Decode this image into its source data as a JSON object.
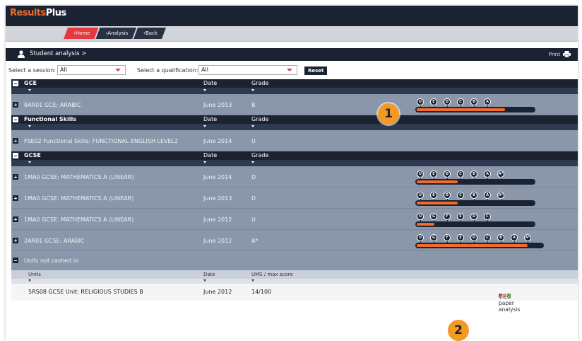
{
  "app": {
    "logo_part1": "Results",
    "logo_part2": "Plus"
  },
  "nav": {
    "home": "Home",
    "analysis": "Analysis",
    "back": "Back"
  },
  "header": {
    "title": "Student analysis >",
    "print": "Print"
  },
  "filters": {
    "session_label": "Select a session:",
    "session_value": "All",
    "qualification_label": "Select a qualification:",
    "qualification_value": "All",
    "reset": "Reset"
  },
  "columns": {
    "date": "Date",
    "grade": "Grade"
  },
  "groups": {
    "gce": {
      "title": "GCE",
      "rows": [
        {
          "name": "8AR01 GCE: ARABIC",
          "date": "June 2013",
          "grade": "B",
          "scale": [
            "U",
            "E",
            "D",
            "C",
            "B",
            "A"
          ],
          "progress": 0.75
        }
      ]
    },
    "functional": {
      "title": "Functional Skills",
      "rows": [
        {
          "name": "FSE02 Functional Skills: FUNCTIONAL ENGLISH LEVEL2",
          "date": "June 2014",
          "grade": "U"
        }
      ]
    },
    "gcse": {
      "title": "GCSE",
      "rows": [
        {
          "name": "1MA0 GCSE: MATHEMATICS A (LINEAR)",
          "date": "June 2014",
          "grade": "D",
          "scale": [
            "U",
            "E",
            "D",
            "C",
            "B",
            "A",
            "A*"
          ],
          "progress": 0.35
        },
        {
          "name": "1MA0 GCSE: MATHEMATICS A (LINEAR)",
          "date": "June 2013",
          "grade": "D",
          "scale": [
            "U",
            "E",
            "D",
            "C",
            "B",
            "A",
            "A*"
          ],
          "progress": 0.35
        },
        {
          "name": "1MA0 GCSE: MATHEMATICS A (LINEAR)",
          "date": "June 2012",
          "grade": "U",
          "scale": [
            "U",
            "G",
            "F",
            "E",
            "D",
            "C"
          ],
          "progress": 0.15
        },
        {
          "name": "2AR01 GCSE: ARABIC",
          "date": "June 2012",
          "grade": "A*",
          "scale": [
            "U",
            "G",
            "F",
            "E",
            "D",
            "C",
            "B",
            "A",
            "A*"
          ],
          "progress": 0.88
        }
      ]
    }
  },
  "units": {
    "title": "Units not cashed in",
    "col_units": "Units",
    "col_date": "Date",
    "col_ums": "UMS / max score",
    "rows": [
      {
        "name": "5RS08 GCSE Unit: RELIGIOUS STUDIES B",
        "date": "June 2012",
        "ums": "14/100",
        "link": "View paper analysis"
      }
    ]
  },
  "callouts": {
    "one": "1",
    "two": "2"
  },
  "colors": {
    "navy": "#1b2333",
    "accent": "#f26b2a",
    "home_red": "#e3393f",
    "row_grey": "#8a97ab",
    "callout": "#f39a22"
  }
}
